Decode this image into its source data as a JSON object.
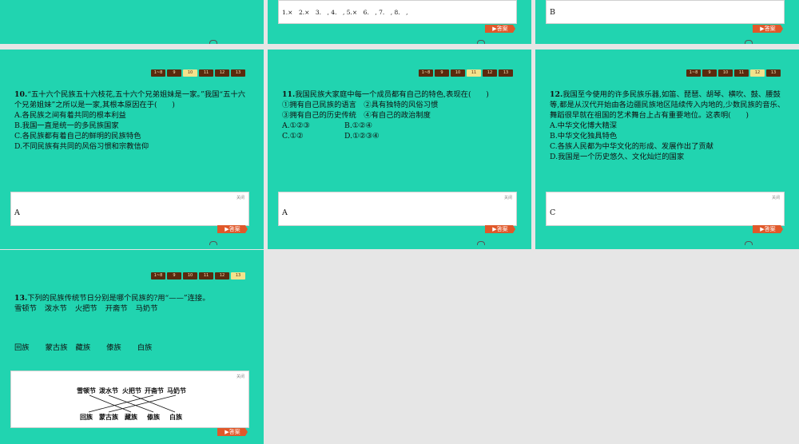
{
  "nav": [
    "1~8",
    "9",
    "10",
    "11",
    "12",
    "13"
  ],
  "answer_button": "答案",
  "close_label": "关闭",
  "top_middle": {
    "answers": "1.×　2.×　3.　, 4.　, 5.×　6.　, 7.　, 8.　,"
  },
  "top_right": {
    "answer": "B"
  },
  "q10": {
    "num": "10.",
    "text": "“五十六个民族五十六枝花,五十六个兄弟姐妹是一家。”我国“五十六个兄弟姐妹”之所以是一家,其根本原因在于(　　)",
    "options": [
      "A.各民族之间有着共同的根本利益",
      "B.我国一直是统一的多民族国家",
      "C.各民族都有着自己的鲜明的民族特色",
      "D.不同民族有共同的风俗习惯和宗教信仰"
    ],
    "answer": "A"
  },
  "q11": {
    "num": "11.",
    "text": "我国民族大家庭中每一个成员都有自己的特色,表现在(　　)",
    "line1": "①拥有自己民族的语言　②具有独特的风俗习惯",
    "line2": "③拥有自己的历史传统　④有自己的政治制度",
    "optA": "A.①②③",
    "optB": "B.①②④",
    "optC": "C.①②",
    "optD": "D.①②③④",
    "answer": "A"
  },
  "q12": {
    "num": "12.",
    "text": "我国至今使用的许多民族乐器,如笛、琵琶、胡琴、横吹、鼓、腰鼓等,都是从汉代开始由各边疆民族地区陆续传入内地的,少数民族的音乐、舞蹈很早就在祖国的艺术舞台上占有重要地位。这表明(　　)",
    "options": [
      "A.中华文化博大精深",
      "B.中华文化独具特色",
      "C.各族人民都为中华文化的形成、发展作出了贡献",
      "D.我国是一个历史悠久、文化灿烂的国家"
    ],
    "answer": "C"
  },
  "q13": {
    "num": "13.",
    "text": "下列的民族传统节日分别是哪个民族的?用“——”连接。",
    "festivals": [
      "雪顿节",
      "泼水节",
      "火把节",
      "开斋节",
      "马奶节"
    ],
    "peoples": [
      "回族",
      "蒙古族",
      "藏族",
      "傣族",
      "白族"
    ]
  },
  "colors": {
    "slide": "#21d4b0",
    "nav": "#5a2a0e",
    "nav_current": "#f3e28c",
    "button": "#e0582a"
  }
}
